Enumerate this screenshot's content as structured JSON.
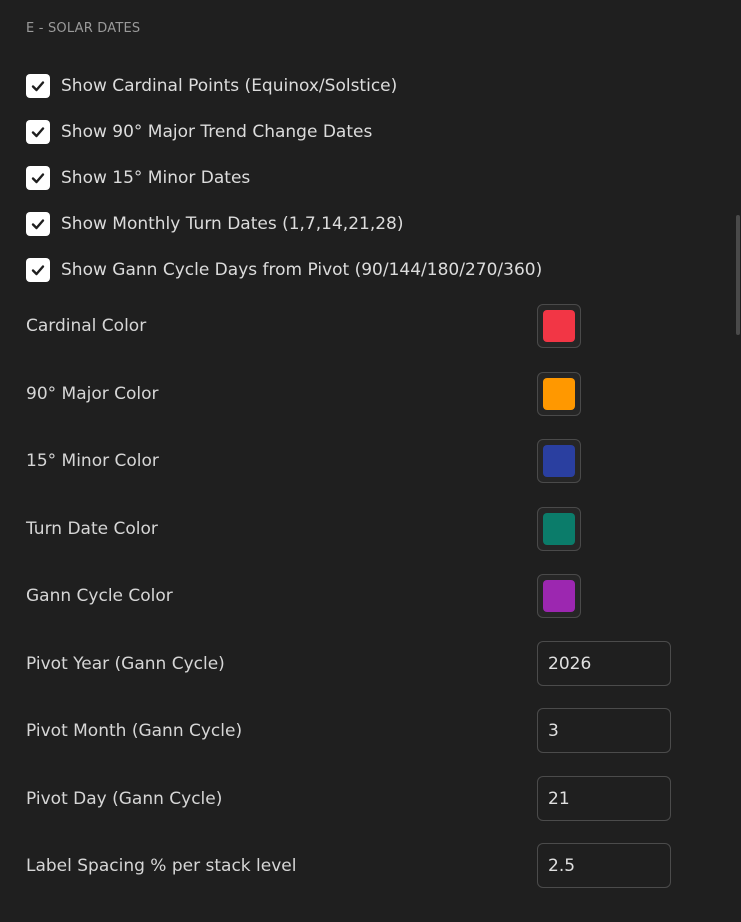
{
  "section": {
    "title": "E - SOLAR DATES"
  },
  "checkboxes": [
    {
      "label": "Show Cardinal Points (Equinox/Solstice)",
      "checked": true
    },
    {
      "label": "Show 90° Major Trend Change Dates",
      "checked": true
    },
    {
      "label": "Show 15° Minor Dates",
      "checked": true
    },
    {
      "label": "Show Monthly Turn Dates (1,7,14,21,28)",
      "checked": true
    },
    {
      "label": "Show Gann Cycle Days from Pivot (90/144/180/270/360)",
      "checked": true
    }
  ],
  "colors": [
    {
      "label": "Cardinal Color",
      "value": "#f23645"
    },
    {
      "label": "90° Major Color",
      "value": "#ff9800"
    },
    {
      "label": "15° Minor Color",
      "value": "#2a3fa0"
    },
    {
      "label": "Turn Date Color",
      "value": "#0b7c6a"
    },
    {
      "label": "Gann Cycle Color",
      "value": "#9c27b0"
    }
  ],
  "inputs": [
    {
      "label": "Pivot Year (Gann Cycle)",
      "value": "2026"
    },
    {
      "label": "Pivot Month (Gann Cycle)",
      "value": "3"
    },
    {
      "label": "Pivot Day (Gann Cycle)",
      "value": "21"
    },
    {
      "label": "Label Spacing % per stack level",
      "value": "2.5"
    }
  ]
}
